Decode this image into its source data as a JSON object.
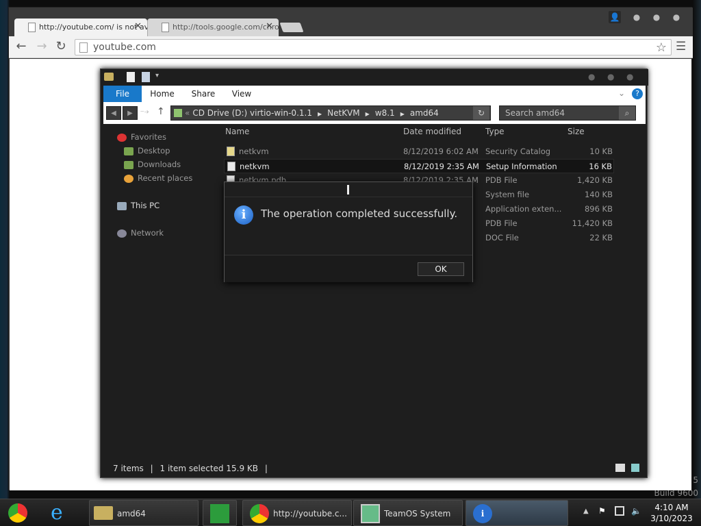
{
  "browser": {
    "tabs": [
      {
        "title": "http://youtube.com/ is not ava"
      },
      {
        "title": "http://tools.google.com/chrom"
      }
    ],
    "address": "youtube.com",
    "colors": {
      "tab_active": "#f2f2f2",
      "frame": "#3b3b3b"
    }
  },
  "explorer": {
    "ribbon_tabs": [
      "File",
      "Home",
      "Share",
      "View"
    ],
    "breadcrumb": [
      "CD Drive (D:) virtio-win-0.1.1",
      "NetKVM",
      "w8.1",
      "amd64"
    ],
    "search_placeholder": "Search amd64",
    "nav": {
      "favorites": "Favorites",
      "desktop": "Desktop",
      "downloads": "Downloads",
      "recent": "Recent places",
      "thispc": "This PC",
      "network": "Network"
    },
    "columns": [
      "Name",
      "Date modified",
      "Type",
      "Size"
    ],
    "files": [
      {
        "name": "netkvm",
        "date": "8/12/2019 6:02 AM",
        "type": "Security Catalog",
        "size": "10 KB"
      },
      {
        "name": "netkvm",
        "date": "8/12/2019 2:35 AM",
        "type": "Setup Information",
        "size": "16 KB"
      },
      {
        "name": "netkvm.pdb",
        "date": "8/12/2019 2:35 AM",
        "type": "PDB File",
        "size": "1,420 KB"
      },
      {
        "name": "",
        "date": "",
        "type": "System file",
        "size": "140 KB"
      },
      {
        "name": "",
        "date": "",
        "type": "Application exten...",
        "size": "896 KB"
      },
      {
        "name": "",
        "date": "",
        "type": "PDB File",
        "size": "11,420 KB"
      },
      {
        "name": "",
        "date": "",
        "type": "DOC File",
        "size": "22 KB"
      }
    ],
    "status": {
      "count": "7 items",
      "selected": "1 item selected  15.9 KB"
    }
  },
  "dialog": {
    "message": "The operation completed successfully.",
    "ok": "OK"
  },
  "taskbar": {
    "items": [
      {
        "label": "amd64"
      },
      {
        "label": "http://youtube.c..."
      },
      {
        "label": "TeamOS System"
      }
    ],
    "time": "4:10 AM",
    "date": "3/10/2023"
  },
  "desktop": {
    "build": "Build 9600",
    "build_digit": "5"
  }
}
